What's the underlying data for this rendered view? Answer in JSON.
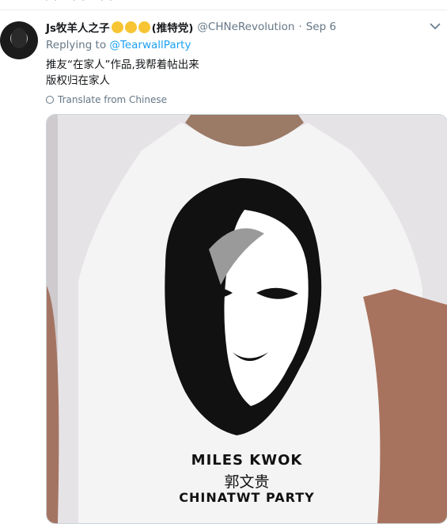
{
  "tweet": {
    "display_name": "Js牧羊人之子",
    "display_name_suffix": "(推特党)",
    "emoji_icons": [
      "raised-fist-icon",
      "raised-fist-icon",
      "raised-fist-icon"
    ],
    "handle": "@CHNeRevolution",
    "separator": "·",
    "date": "Sep 6",
    "replying_prefix": "Replying to",
    "replying_to": "@TearwallParty",
    "text_line1": "推友“在家人”作品,我帮着帖出来",
    "text_line2": "版权归在家人",
    "translate_label": "Translate from Chinese"
  },
  "image": {
    "line1": "MILES KWOK",
    "line2": "郭文贵",
    "line3": "CHINATWT PARTY"
  }
}
